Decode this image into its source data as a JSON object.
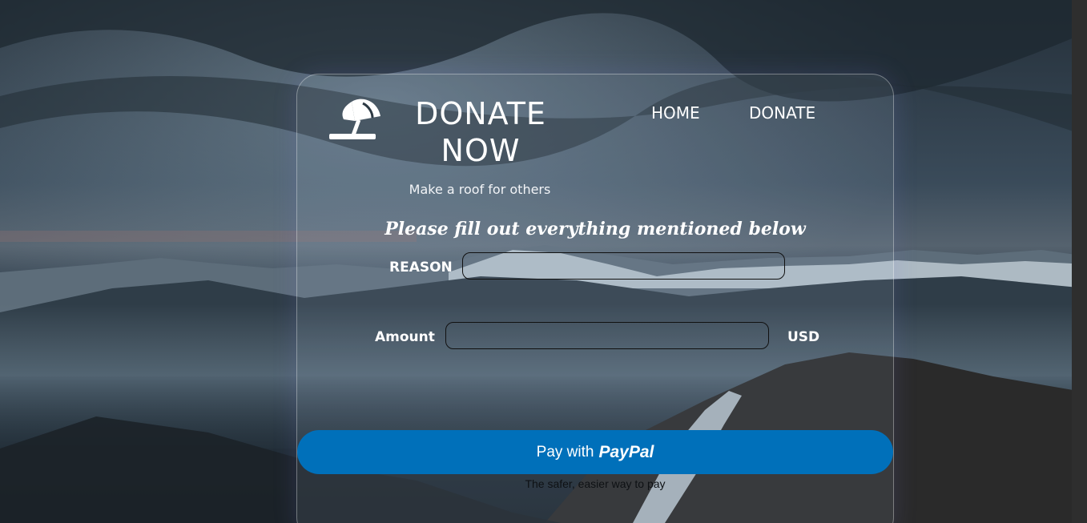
{
  "header": {
    "brand_title": "DONATE NOW",
    "tagline": "Make a roof for others",
    "nav": [
      {
        "label": "HOME"
      },
      {
        "label": "DONATE"
      }
    ]
  },
  "form": {
    "instructions": "Please fill out everything mentioned below",
    "reason": {
      "label": "REASON",
      "value": "",
      "placeholder": ""
    },
    "amount": {
      "label": "Amount",
      "value": "",
      "placeholder": "",
      "currency": "USD"
    }
  },
  "payment": {
    "button_prefix": "Pay with",
    "button_brand": "PayPal",
    "note": "The safer, easier way to pay",
    "button_color": "#0070ba"
  },
  "icons": {
    "logo": "umbrella-beach-icon"
  }
}
